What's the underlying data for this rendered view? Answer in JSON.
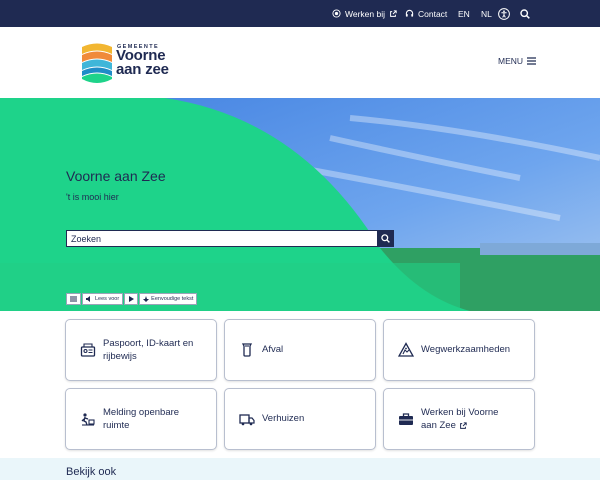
{
  "topbar": {
    "jobs_label": "Werken bij",
    "contact_label": "Contact",
    "lang_en": "EN",
    "lang_nl": "NL"
  },
  "header": {
    "logo_small": "GEMEENTE",
    "logo_line1": "Voorne",
    "logo_line2": "aan zee",
    "menu_label": "MENU"
  },
  "hero": {
    "title": "Voorne aan Zee",
    "subtitle": "'t is mooi hier",
    "search_placeholder": "Zoeken",
    "readspeaker_label": "Lees voor",
    "easy_text_label": "Eenvoudige tekst"
  },
  "cards": [
    {
      "line1": "Paspoort, ID-kaart en",
      "line2": "rijbewijs",
      "icon": "id-card-icon"
    },
    {
      "line1": "Afval",
      "line2": "",
      "icon": "waste-bin-icon"
    },
    {
      "line1": "Wegwerkzaamheden",
      "line2": "",
      "icon": "roadworks-icon"
    },
    {
      "line1": "Melding openbare",
      "line2": "ruimte",
      "icon": "report-icon"
    },
    {
      "line1": "Verhuizen",
      "line2": "",
      "icon": "moving-truck-icon"
    },
    {
      "line1": "Werken bij Voorne",
      "line2": "aan Zee",
      "icon": "briefcase-icon"
    }
  ],
  "more": {
    "title": "Bekijk ook"
  },
  "colors": {
    "navy": "#1f2a52",
    "green": "#1ed38a",
    "light": "#eaf6fa"
  }
}
